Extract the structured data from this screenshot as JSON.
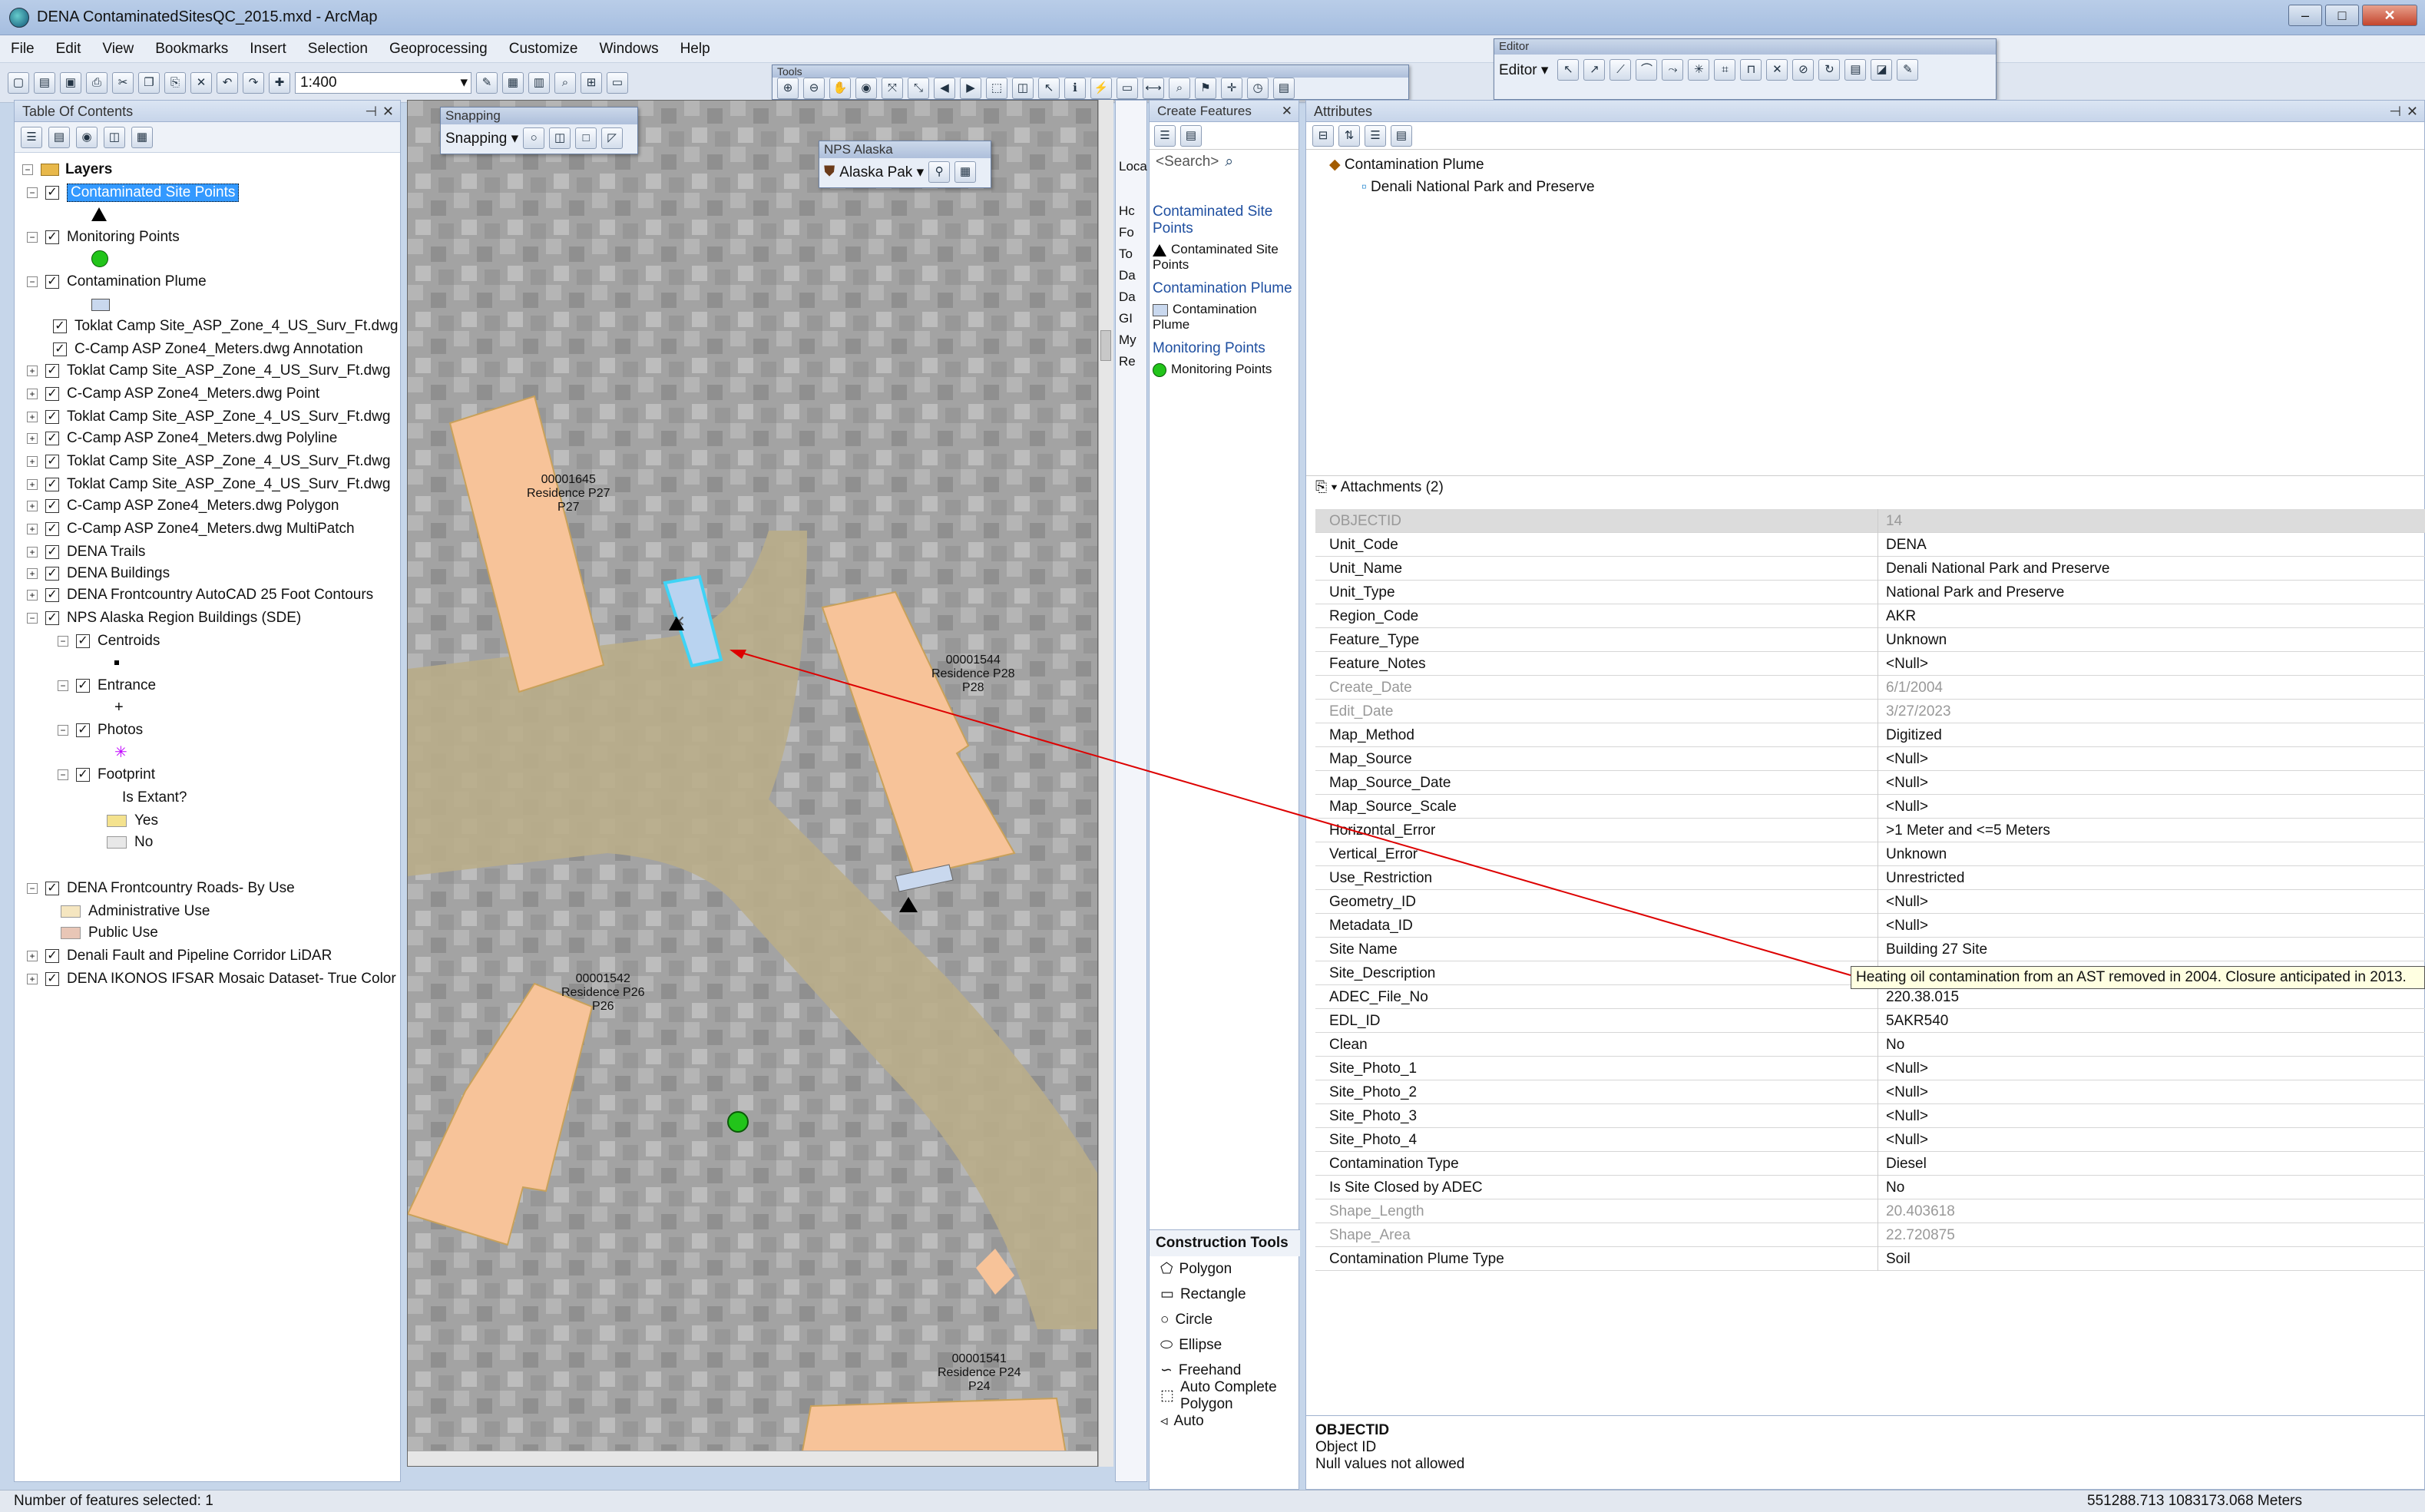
{
  "window": {
    "title": "DENA ContaminatedSitesQC_2015.mxd - ArcMap"
  },
  "menu": [
    "File",
    "Edit",
    "View",
    "Bookmarks",
    "Insert",
    "Selection",
    "Geoprocessing",
    "Customize",
    "Windows",
    "Help"
  ],
  "toolbar": {
    "scale": "1:400",
    "tools_title": "Tools",
    "editor_title": "Editor",
    "editor_menu": "Editor ▾"
  },
  "toc": {
    "title": "Table Of Contents",
    "layers_label": "Layers",
    "items": [
      {
        "label": "Contaminated Site Points",
        "selected": true
      },
      {
        "label": "Monitoring Points"
      },
      {
        "label": "Contamination Plume"
      },
      {
        "label": "Toklat Camp Site_ASP_Zone_4_US_Surv_Ft.dwg"
      },
      {
        "label": "C-Camp ASP Zone4_Meters.dwg Annotation"
      },
      {
        "label": "Toklat Camp Site_ASP_Zone_4_US_Surv_Ft.dwg"
      },
      {
        "label": "C-Camp ASP Zone4_Meters.dwg Point"
      },
      {
        "label": "Toklat Camp Site_ASP_Zone_4_US_Surv_Ft.dwg"
      },
      {
        "label": "C-Camp ASP Zone4_Meters.dwg Polyline"
      },
      {
        "label": "Toklat Camp Site_ASP_Zone_4_US_Surv_Ft.dwg"
      },
      {
        "label": "Toklat Camp Site_ASP_Zone_4_US_Surv_Ft.dwg"
      },
      {
        "label": "C-Camp ASP Zone4_Meters.dwg Polygon"
      },
      {
        "label": "C-Camp ASP Zone4_Meters.dwg MultiPatch"
      },
      {
        "label": "DENA Trails"
      },
      {
        "label": "DENA Buildings"
      },
      {
        "label": "DENA Frontcountry AutoCAD 25 Foot Contours"
      },
      {
        "label": "NPS Alaska Region Buildings (SDE)"
      },
      {
        "label": "Centroids"
      },
      {
        "label": "Entrance"
      },
      {
        "label": "Photos"
      },
      {
        "label": "Footprint"
      },
      {
        "label": "Is Extant?"
      },
      {
        "label": "Yes"
      },
      {
        "label": "No"
      },
      {
        "label": "DENA Frontcountry Roads- By Use"
      },
      {
        "label": "Administrative Use"
      },
      {
        "label": "Public Use"
      },
      {
        "label": "Denali Fault and Pipeline Corridor LiDAR"
      },
      {
        "label": "DENA IKONOS IFSAR Mosaic Dataset- True Color"
      }
    ]
  },
  "snapping": {
    "title": "Snapping",
    "menu": "Snapping ▾"
  },
  "nps": {
    "title": "NPS Alaska",
    "menu": "Alaska Pak ▾"
  },
  "map": {
    "labels": [
      {
        "text": "00001645\nResidence P27\nP27"
      },
      {
        "text": "00001544\nResidence P28\nP28"
      },
      {
        "text": "00001542\nResidence P26\nP26"
      },
      {
        "text": "00001541\nResidence P24\nP24"
      }
    ]
  },
  "create": {
    "title": "Create Features",
    "search": "<Search>",
    "groups": [
      {
        "header": "Contaminated Site Points",
        "item": "Contaminated Site Points"
      },
      {
        "header": "Contamination Plume",
        "item": "Contamination Plume"
      },
      {
        "header": "Monitoring Points",
        "item": "Monitoring Points"
      }
    ],
    "construction_title": "Construction Tools",
    "tools": [
      "Polygon",
      "Rectangle",
      "Circle",
      "Ellipse",
      "Freehand",
      "Auto Complete Polygon",
      "Auto"
    ]
  },
  "narrow": {
    "letters": [
      "Loca",
      "Hc",
      "Fo",
      "To",
      "Da",
      "Da",
      "GI",
      "My",
      "Re"
    ]
  },
  "attributes": {
    "title": "Attributes",
    "tree_root": "Contamination Plume",
    "tree_child": "Denali National Park and Preserve",
    "attachments": "Attachments (2)",
    "rows": [
      {
        "f": "OBJECTID",
        "v": "14",
        "dim": true
      },
      {
        "f": "Unit_Code",
        "v": "DENA"
      },
      {
        "f": "Unit_Name",
        "v": "Denali National Park and Preserve"
      },
      {
        "f": "Unit_Type",
        "v": "National Park and Preserve"
      },
      {
        "f": "Region_Code",
        "v": "AKR"
      },
      {
        "f": "Feature_Type",
        "v": "Unknown"
      },
      {
        "f": "Feature_Notes",
        "v": "<Null>"
      },
      {
        "f": "Create_Date",
        "v": "6/1/2004",
        "dim": true
      },
      {
        "f": "Edit_Date",
        "v": "3/27/2023",
        "dim": true
      },
      {
        "f": "Map_Method",
        "v": "Digitized"
      },
      {
        "f": "Map_Source",
        "v": "<Null>"
      },
      {
        "f": "Map_Source_Date",
        "v": "<Null>"
      },
      {
        "f": "Map_Source_Scale",
        "v": "<Null>"
      },
      {
        "f": "Horizontal_Error",
        "v": ">1 Meter and <=5 Meters"
      },
      {
        "f": "Vertical_Error",
        "v": "Unknown"
      },
      {
        "f": "Use_Restriction",
        "v": "Unrestricted"
      },
      {
        "f": "Geometry_ID",
        "v": "<Null>"
      },
      {
        "f": "Metadata_ID",
        "v": "<Null>"
      },
      {
        "f": "Site Name",
        "v": "Building 27 Site"
      },
      {
        "f": "Site_Description",
        "v": ""
      },
      {
        "f": "ADEC_File_No",
        "v": "220.38.015"
      },
      {
        "f": "EDL_ID",
        "v": "5AKR540"
      },
      {
        "f": "Clean",
        "v": "No"
      },
      {
        "f": "Site_Photo_1",
        "v": "<Null>"
      },
      {
        "f": "Site_Photo_2",
        "v": "<Null>"
      },
      {
        "f": "Site_Photo_3",
        "v": "<Null>"
      },
      {
        "f": "Site_Photo_4",
        "v": "<Null>"
      },
      {
        "f": "Contamination Type",
        "v": "Diesel"
      },
      {
        "f": "Is Site Closed by ADEC",
        "v": "No"
      },
      {
        "f": "Shape_Length",
        "v": "20.403618",
        "dim": true
      },
      {
        "f": "Shape_Area",
        "v": "22.720875",
        "dim": true
      },
      {
        "f": "Contamination Plume Type",
        "v": "Soil"
      }
    ],
    "tooltip": "Heating oil contamination from an AST removed in 2004. Closure anticipated in 2013.",
    "desc_title": "OBJECTID",
    "desc_sub": "Object ID",
    "desc_note": "Null values not allowed"
  },
  "status": {
    "left": "Number of features selected: 1",
    "right": "551288.713  1083173.068 Meters"
  }
}
